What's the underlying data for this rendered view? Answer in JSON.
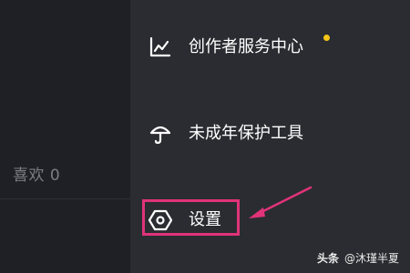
{
  "profile": {
    "likes_text": "喜欢 0"
  },
  "drawer": {
    "items": [
      {
        "label": "创作者服务中心",
        "icon": "chart-icon",
        "has_notification_dot": true
      },
      {
        "label": "未成年保护工具",
        "icon": "umbrella-icon",
        "has_notification_dot": false
      },
      {
        "label": "设置",
        "icon": "hexagon-settings-icon",
        "has_notification_dot": false,
        "highlighted": true
      }
    ]
  },
  "watermark": {
    "brand": "头条",
    "author": "@沐瑾半夏"
  },
  "colors": {
    "drawer_bg": "#2b2c31",
    "left_bg": "#1f2025",
    "text": "#ffffff",
    "dot": "#f5c518",
    "highlight": "#e0337a"
  }
}
